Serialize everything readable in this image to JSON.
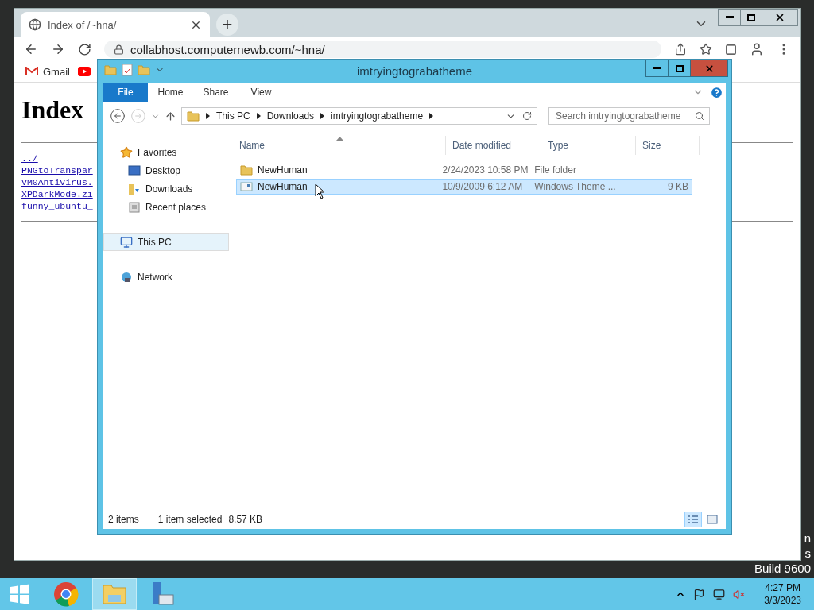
{
  "browser": {
    "tabs": [
      {
        "title": "Index of /~hna/",
        "selected": true
      }
    ],
    "new_tab": "+",
    "url": "collabhost.computernewb.com/~hna/",
    "bookmarks": [
      {
        "kind": "gmail",
        "label": "Gmail"
      },
      {
        "kind": "video"
      }
    ],
    "page": {
      "heading": "Index",
      "links": [
        "../",
        "PNGtoTranspar",
        "VM0Antivirus.",
        "XPDarkMode.zi",
        "funny_ubuntu_"
      ]
    }
  },
  "explorer": {
    "title": "imtryingtograbatheme",
    "ribbon_tabs": [
      {
        "label": "File",
        "kind": "file"
      },
      {
        "label": "Home",
        "kind": "tab"
      },
      {
        "label": "Share",
        "kind": "tab"
      },
      {
        "label": "View",
        "kind": "tab"
      }
    ],
    "breadcrumbs": [
      "This PC",
      "Downloads",
      "imtryingtograbatheme"
    ],
    "search": {
      "placeholder": "Search imtryingtograbatheme"
    },
    "nav": [
      {
        "label": "Favorites",
        "kind": "star",
        "selected": false,
        "children": [
          {
            "label": "Desktop",
            "kind": "desktop",
            "selected": false
          },
          {
            "label": "Downloads",
            "kind": "downloads",
            "selected": false
          },
          {
            "label": "Recent places",
            "kind": "recent",
            "selected": false
          }
        ]
      },
      {
        "label": "This PC",
        "kind": "pc",
        "selected": true
      },
      {
        "label": "Network",
        "kind": "network",
        "selected": false
      }
    ],
    "columns": [
      {
        "label": "Name",
        "sorted": true
      },
      {
        "label": "Date modified",
        "sorted": false
      },
      {
        "label": "Type",
        "sorted": false
      },
      {
        "label": "Size",
        "sorted": false
      }
    ],
    "rows": [
      {
        "kind": "folder",
        "name": "NewHuman",
        "date": "2/24/2023 10:58 PM",
        "type": "File folder",
        "selected": false
      },
      {
        "kind": "theme",
        "name": "NewHuman",
        "date": "10/9/2009 6:12 AM",
        "type": "Windows Theme ...",
        "size": "9 KB",
        "selected": true
      }
    ],
    "status": {
      "count": "2 items",
      "selection": "1 item selected",
      "size": "8.57 KB"
    },
    "views": [
      {
        "kind": "details",
        "selected": true
      },
      {
        "kind": "tiles",
        "selected": false
      }
    ]
  },
  "desktop_text": [
    "n",
    "s",
    "Build 9600"
  ],
  "taskbar": {
    "items": [
      {
        "kind": "browser",
        "selected": false
      },
      {
        "kind": "explorer",
        "selected": true
      },
      {
        "kind": "server",
        "selected": false
      }
    ],
    "time": "4:27 PM",
    "date": "3/3/2023"
  }
}
